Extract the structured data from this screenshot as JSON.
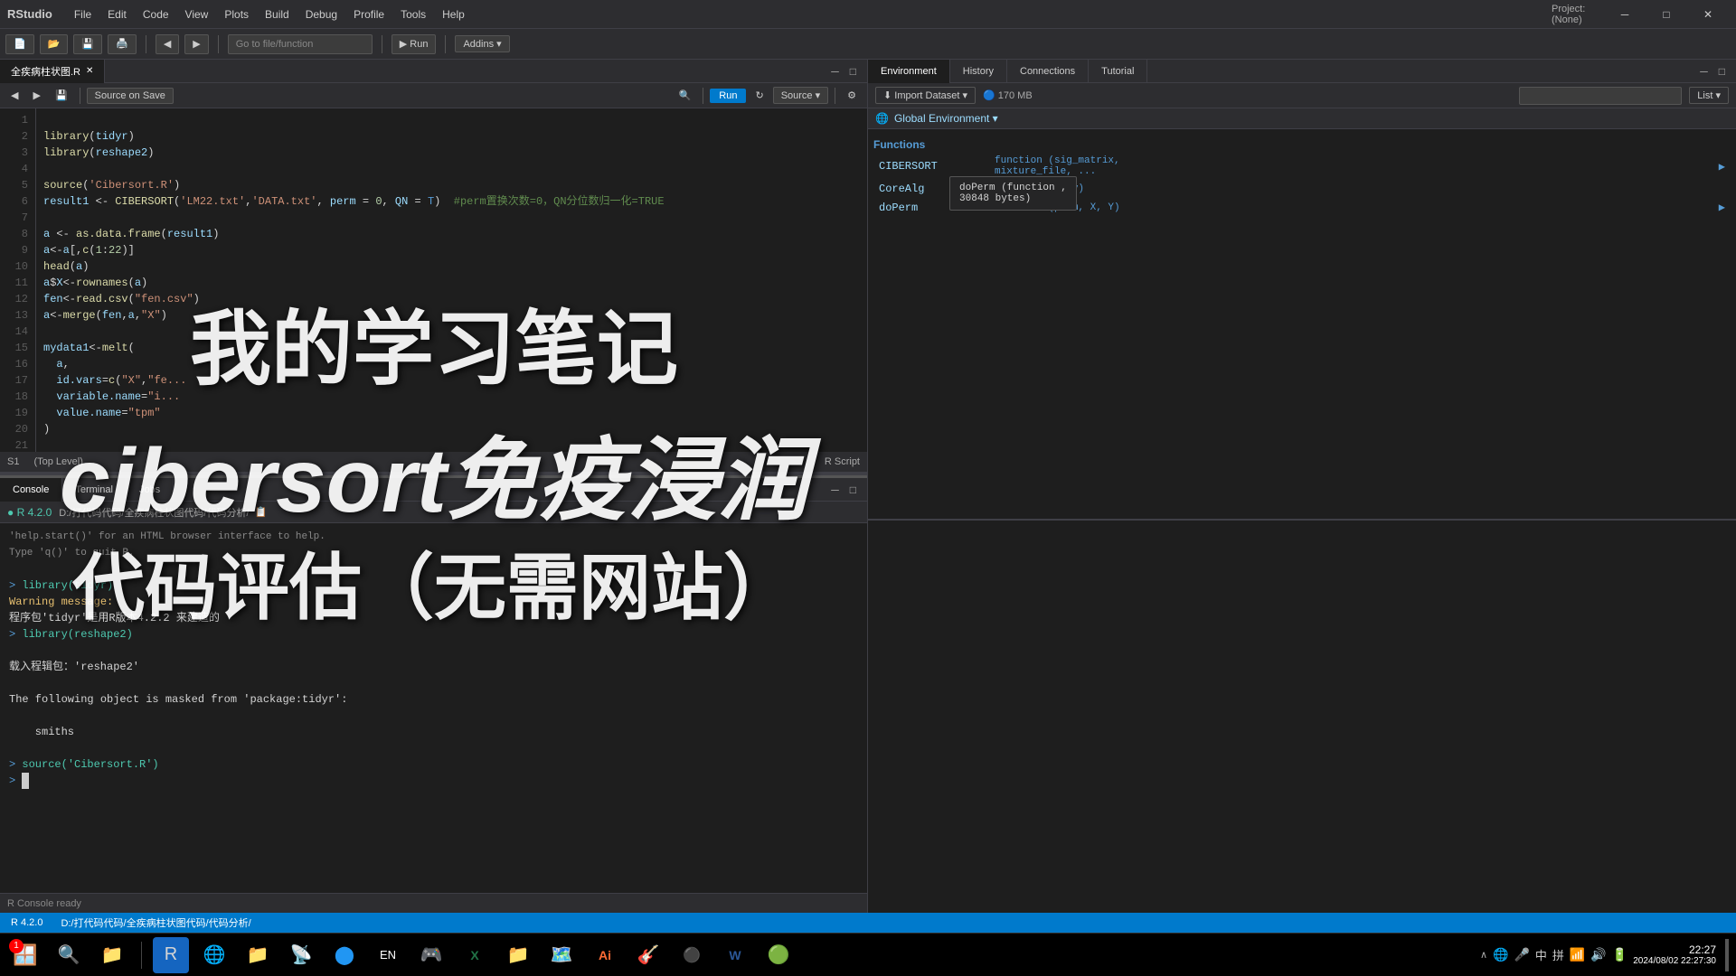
{
  "titlebar": {
    "app_name": "RStudio",
    "menus": [
      "File",
      "Edit",
      "Code",
      "View",
      "Plots",
      "Build",
      "Debug",
      "Profile",
      "Tools",
      "Help"
    ],
    "minimize": "─",
    "maximize": "□",
    "close": "✕",
    "project": "Project: (None)"
  },
  "toolbar": {
    "new_file": "📄",
    "open_file": "📂",
    "save": "💾",
    "run_btn": "▶",
    "go_to_function": "Go to file/function",
    "addins": "Addins ▾"
  },
  "editor": {
    "tab_label": "全疾病柱状图.R",
    "tab_close": "✕",
    "source_on_save": "Source on Save",
    "run_label": "Run",
    "source_label": "Source ▾",
    "status_level": "S1",
    "status_context": "(Top Level)",
    "status_type": "R Script",
    "lines": [
      "library(tidyr)",
      "library(reshape2)",
      "",
      "source('Cibersort.R')",
      "result1 <- CIBERSORT('LM22.txt','DATA.txt', perm = 0, QN = T)  #perm置换次数=0，QN分位数归一化=TRUE",
      "",
      "a <- as.data.frame(result1)",
      "a<-a[,c(1:22)]",
      "head(a)",
      "a$X<-rownames(a)",
      "fen<-read.csv(\"fen.csv\")",
      "a<-merge(fen,a,\"X\")",
      "",
      "mydata1<-melt(",
      "  a,",
      "  id.vars=c(\"X\",\"fe...",
      "  variable.name=\"i...",
      "  value.name=\"tpm\"",
      ")"
    ]
  },
  "env_panel": {
    "tabs": [
      "Environment",
      "History",
      "Connections",
      "Tutorial"
    ],
    "active_tab": "Environment",
    "history_label": "History",
    "import_dataset": "Import Dataset ▾",
    "memory": "170 MB",
    "list_label": "List ▾",
    "global_env": "Global Environment ▾",
    "search_placeholder": "",
    "functions_label": "Functions",
    "functions": [
      {
        "name": "CIBERSORT",
        "type": "function",
        "value": "(sig_matrix, mixture_file, ..."
      },
      {
        "name": "CoreAlg",
        "type": "function",
        "value": "(X, y)"
      },
      {
        "name": "doPerm",
        "type": "function",
        "value": "(perm, X, Y)"
      }
    ],
    "tooltip_text": "doPerm (function ,\n30848 bytes)"
  },
  "console": {
    "tabs": [
      "Console",
      "Terminal",
      "Jobs"
    ],
    "active_tab": "Console",
    "r_version": "R 4.2.0",
    "path": "D:/打代码代码/全疾病柱状图代码/代码分析/",
    "help_text": "'help.start()' for an HTML browser interface to help.",
    "quit_text": "Type 'q()' to quit R.",
    "lines": [
      {
        "type": "prompt",
        "text": "> library(tidyr)"
      },
      {
        "type": "warn",
        "text": "Warning message:"
      },
      {
        "type": "text",
        "text": "程序包'tidyr'是用R版本4.2.2 来建造的"
      },
      {
        "type": "prompt",
        "text": "> library(reshape2)"
      },
      {
        "type": "text",
        "text": ""
      },
      {
        "type": "text",
        "text": "载入程辑包：'reshape2'"
      },
      {
        "type": "text",
        "text": ""
      },
      {
        "type": "text",
        "text": "The following object is masked from 'package:tidyr':"
      },
      {
        "type": "text",
        "text": ""
      },
      {
        "type": "text",
        "text": "    smiths"
      },
      {
        "type": "text",
        "text": ""
      },
      {
        "type": "prompt",
        "text": "> source('Cibersort.R')"
      },
      {
        "type": "prompt",
        "text": "> "
      }
    ]
  },
  "right_bottom": {
    "content": ""
  },
  "statusbar": {
    "r_version": "R 4.2.0",
    "path_label": "D:/打代码代码/全疾病柱状图代码/代码分析/"
  },
  "watermark": {
    "title": "我的学习笔记",
    "sub1": "cibersort免疫浸润",
    "sub2": "代码评估（无需网站）"
  },
  "taskbar": {
    "icons": [
      "🪟",
      "🔍",
      "📁",
      "🔵",
      "🌐",
      "📁",
      "📡",
      "🔵",
      "EN",
      "🎮",
      "📊",
      "📁",
      "🗺️",
      "🎨",
      "🎸",
      "🐙",
      "📝",
      "🟢"
    ],
    "notification_badge": "1",
    "time": "22:27",
    "date": "2024/08/02 22:27:30",
    "sys_icons": [
      "🔔",
      "🌐",
      "🎤",
      "中",
      "拼",
      "📶",
      "🔊",
      "🔋"
    ]
  }
}
